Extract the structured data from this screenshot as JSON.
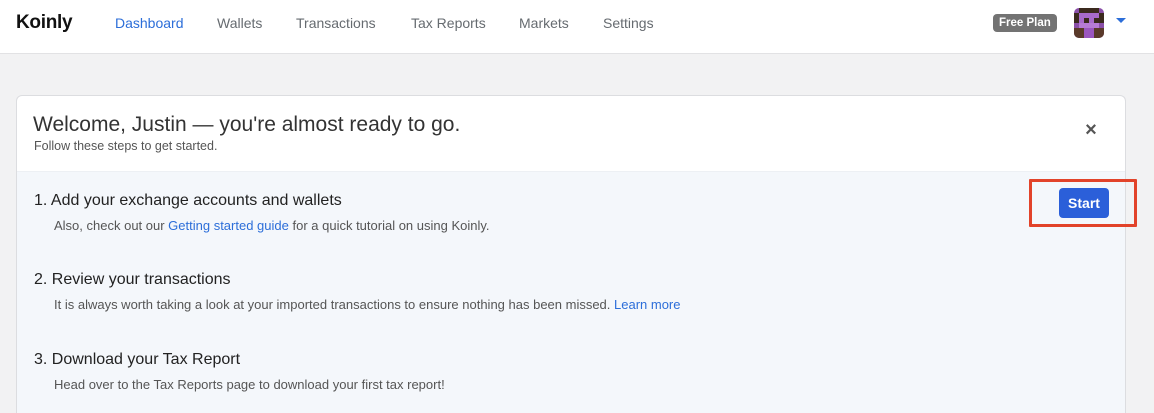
{
  "app": {
    "logo": "Koinly"
  },
  "nav": {
    "items": [
      {
        "label": "Dashboard",
        "active": true
      },
      {
        "label": "Wallets",
        "active": false
      },
      {
        "label": "Transactions",
        "active": false
      },
      {
        "label": "Tax Reports",
        "active": false
      },
      {
        "label": "Markets",
        "active": false
      },
      {
        "label": "Settings",
        "active": false
      }
    ],
    "plan_badge": "Free Plan",
    "avatar_icon": "pixel-avatar-icon",
    "menu_icon": "caret-down-icon"
  },
  "welcome": {
    "title": "Welcome, Justin — you're almost ready to go.",
    "subtitle": "Follow these steps to get started.",
    "close_icon": "close-icon",
    "close_glyph": "×"
  },
  "steps": [
    {
      "title": "1.  Add your exchange accounts and wallets",
      "desc_before": "Also, check out our ",
      "link": "Getting started guide",
      "desc_after": " for a quick tutorial on using Koinly."
    },
    {
      "title": "2.  Review your transactions",
      "desc_before": "It is always worth taking a look at your imported transactions to ensure nothing has been missed. ",
      "link": "Learn more",
      "desc_after": ""
    },
    {
      "title": "3.  Download your Tax Report",
      "desc_before": "Head over to the Tax Reports page to download your first tax report!",
      "link": "",
      "desc_after": ""
    }
  ],
  "start_button": {
    "label": "Start"
  },
  "colors": {
    "accent": "#2c6ed9",
    "button": "#2b5fd9",
    "highlight": "#e2432a",
    "badge": "#737373"
  }
}
